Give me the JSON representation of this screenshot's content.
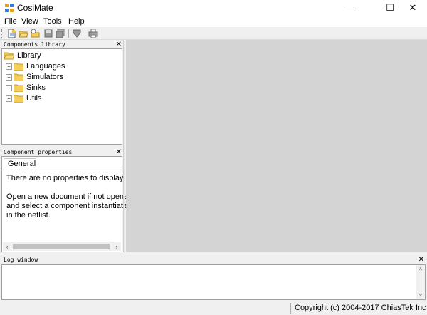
{
  "window": {
    "title": "CosiMate",
    "minimize_glyph": "—",
    "maximize_glyph": "☐",
    "close_glyph": "✕"
  },
  "menu": [
    "File",
    "View",
    "Tools",
    "Help"
  ],
  "toolbar": {
    "icons": [
      "new-document-icon",
      "open-folder-icon",
      "open-recent-icon",
      "save-icon",
      "save-all-icon",
      "netlist-icon",
      "print-icon"
    ]
  },
  "components_library": {
    "header": "Components library",
    "close_glyph": "✕",
    "root": "Library",
    "items": [
      "Languages",
      "Simulators",
      "Sinks",
      "Utils"
    ],
    "expander_glyph": "+"
  },
  "component_properties": {
    "header": "Component properties",
    "close_glyph": "✕",
    "tab": "General",
    "lines": [
      "There are no properties to display.",
      "",
      "Open a new document if not opened,",
      "and select a component instantiated",
      "in the netlist."
    ],
    "scroll_left": "‹",
    "scroll_right": "›"
  },
  "log_window": {
    "header": "Log window",
    "close_glyph": "✕",
    "scroll_up": "˄",
    "scroll_down": "˅"
  },
  "status": {
    "copyright": "Copyright (c) 2004-2017 ChiasTek Inc"
  },
  "colors": {
    "chrome": "#f0f0f0",
    "document_area": "#d4d4d4",
    "folder_yellow": "#f5cf5a"
  }
}
